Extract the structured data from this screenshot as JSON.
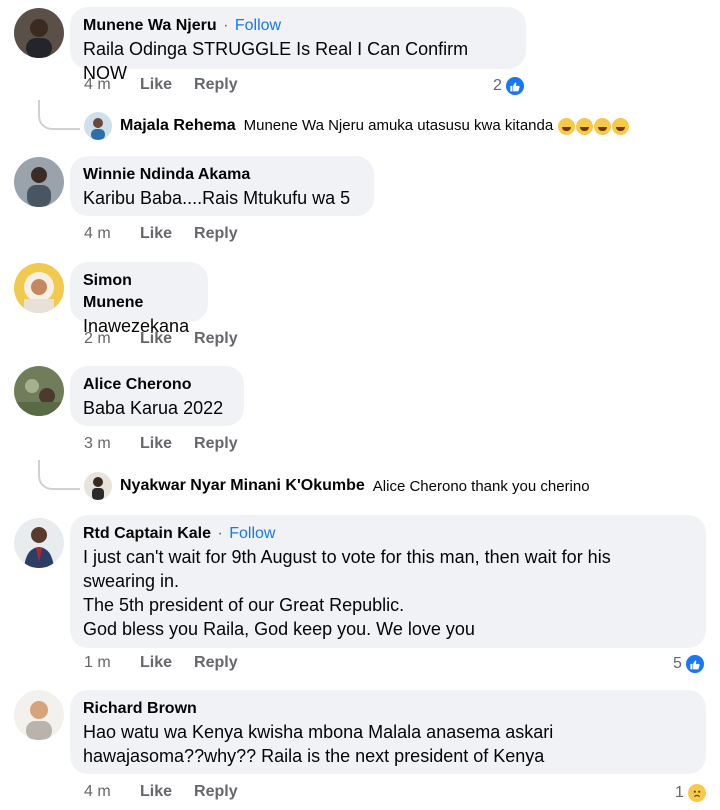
{
  "comments": [
    {
      "name": "Munene Wa Njeru",
      "follow": "Follow",
      "text": "Raila Odinga STRUGGLE Is Real I Can Confirm NOW",
      "time": "4 m",
      "like": "Like",
      "reply": "Reply",
      "reactions": "2"
    },
    {
      "name": "Winnie Ndinda Akama",
      "text": "Karibu Baba....Rais Mtukufu wa 5",
      "time": "4 m",
      "like": "Like",
      "reply": "Reply"
    },
    {
      "name": "Simon Munene",
      "text": "Inawezekana",
      "time": "2 m",
      "like": "Like",
      "reply": "Reply"
    },
    {
      "name": "Alice Cherono",
      "text": "Baba Karua 2022",
      "time": "3 m",
      "like": "Like",
      "reply": "Reply"
    },
    {
      "name": "Rtd Captain Kale",
      "follow": "Follow",
      "text_lines": [
        "I just can't wait for 9th August to vote for this man, then wait for his",
        "swearing in.",
        "The 5th president of our Great Republic.",
        "God bless you Raila, God keep you. We love you"
      ],
      "time": "1 m",
      "like": "Like",
      "reply": "Reply",
      "reactions": "5"
    },
    {
      "name": "Richard Brown",
      "text_lines": [
        "Hao watu wa Kenya kwisha mbona Malala anasema askari",
        "hawajasoma??why?? Raila is the next president of Kenya"
      ],
      "time": "4 m",
      "like": "Like",
      "reply": "Reply",
      "reactions": "1"
    }
  ],
  "replies": [
    {
      "name": "Majala Rehema",
      "text": "Munene Wa Njeru amuka utasusu kwa kitanda",
      "emoji_count": 4
    },
    {
      "name": "Nyakwar Nyar Minani K'Okumbe",
      "text": "Alice Cherono thank you cherino"
    }
  ],
  "colors": {
    "bubble": "#f0f2f5",
    "follow": "#1877f2",
    "meta": "#65676b"
  },
  "icons": [
    "like-reaction-icon",
    "sad-reaction-icon",
    "laughing-emoji-icon"
  ]
}
